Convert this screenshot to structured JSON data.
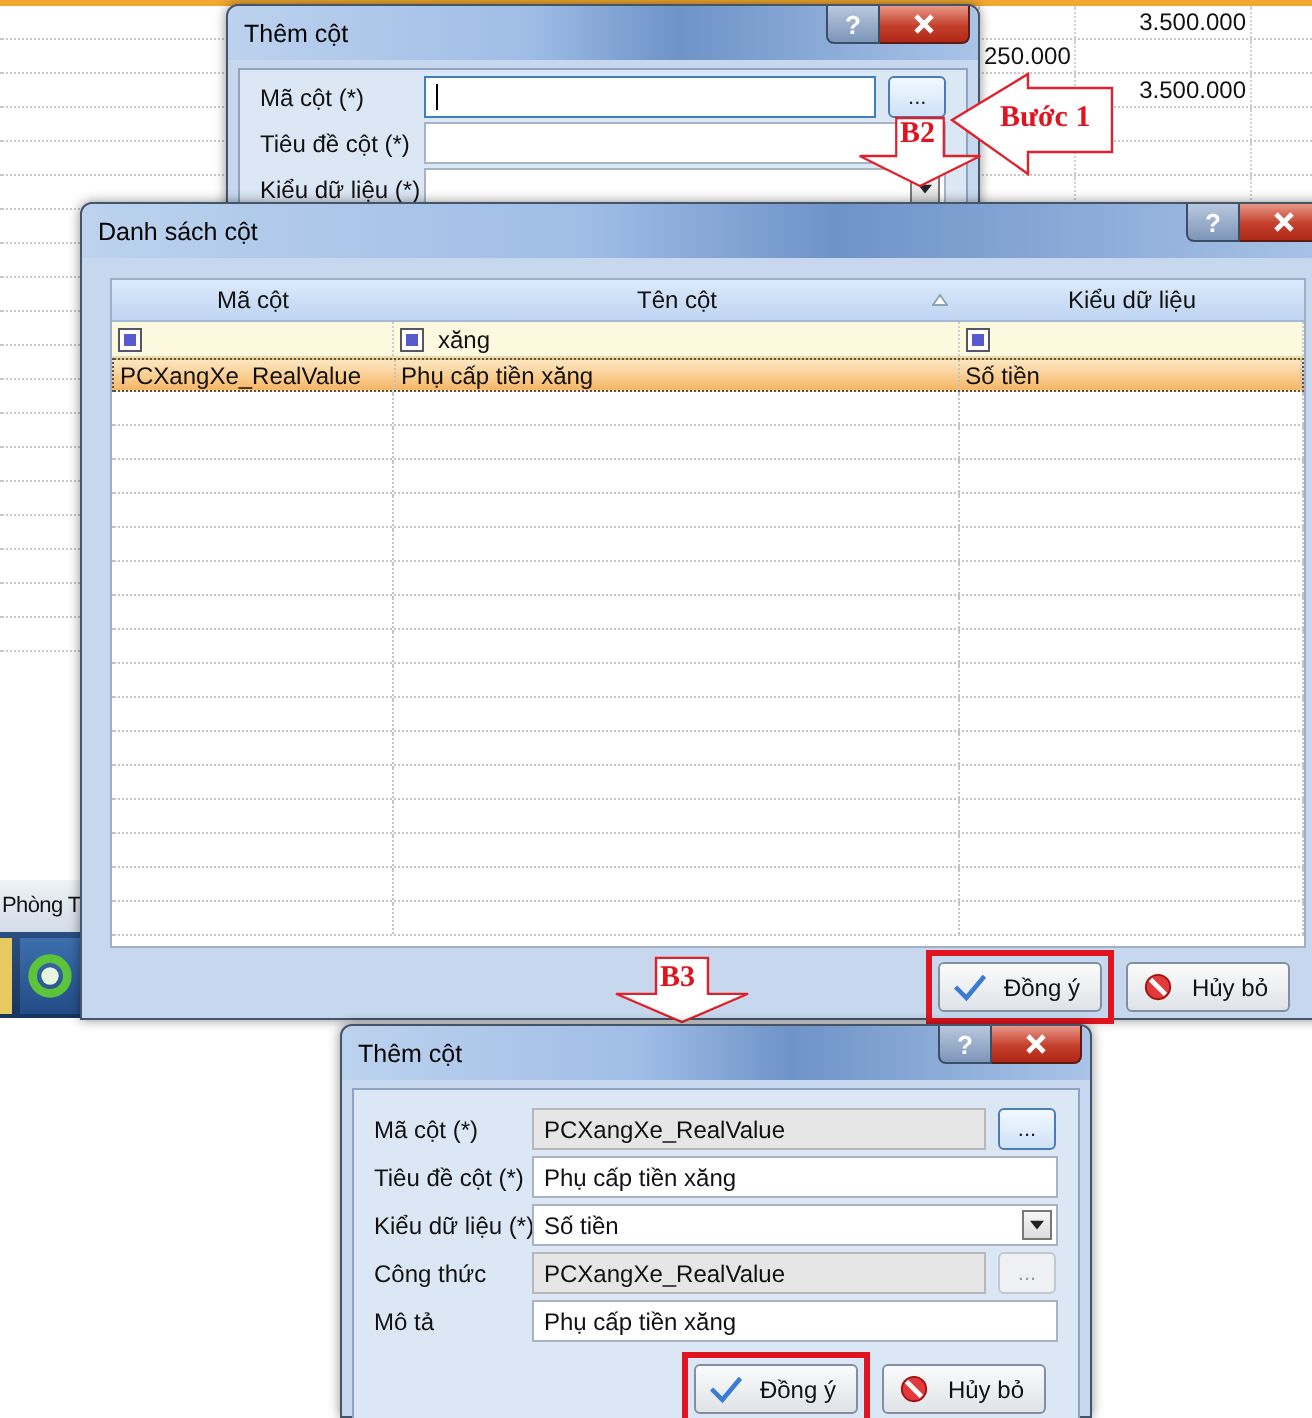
{
  "sheet": {
    "rows": [
      {
        "column_3": "3.500.000"
      },
      {
        "column_2": "250.000"
      },
      {
        "column_3": "3.500.000"
      }
    ],
    "tab": "Phòng T"
  },
  "add_column_dialogs": [
    {
      "title": "Thêm cột",
      "help_label": "?",
      "fields": [
        {
          "label": "Mã cột (*)",
          "kind": "browse",
          "focused": true,
          "disabled": false,
          "browse_label": "...",
          "browse_disabled": false
        },
        {
          "label": "Tiêu đề cột (*)",
          "kind": "text",
          "focused": false,
          "disabled": false
        },
        {
          "label": "Kiểu dữ liệu (*)",
          "kind": "select",
          "focused": false,
          "disabled": false
        }
      ]
    },
    {
      "title": "Thêm cột",
      "help_label": "?",
      "fields": [
        {
          "label": "Mã cột (*)",
          "kind": "browse",
          "value": "PCXangXe_RealValue",
          "focused": false,
          "disabled": true,
          "browse_label": "...",
          "browse_disabled": false
        },
        {
          "label": "Tiêu đề cột (*)",
          "kind": "text",
          "value": "Phụ cấp tiền xăng",
          "focused": false,
          "disabled": false
        },
        {
          "label": "Kiểu dữ liệu (*)",
          "kind": "select",
          "value": "Số tiền",
          "focused": false,
          "disabled": false
        },
        {
          "label": "Công thức",
          "kind": "browse",
          "value": "PCXangXe_RealValue",
          "focused": false,
          "disabled": true,
          "browse_label": "...",
          "browse_disabled": true
        },
        {
          "label": "Mô tả",
          "kind": "text",
          "value": "Phụ cấp tiền xăng",
          "focused": false,
          "disabled": false
        }
      ],
      "buttons": [
        {
          "label": "Đồng ý",
          "kind": "ok",
          "highlighted": true
        },
        {
          "label": "Hủy bỏ",
          "kind": "cancel",
          "highlighted": false
        }
      ]
    }
  ],
  "column_list_dialog": {
    "title": "Danh sách cột",
    "help_label": "?",
    "columns": [
      {
        "label": "Mã cột",
        "sorted": false
      },
      {
        "label": "Tên cột",
        "sorted": true,
        "filter": "xăng"
      },
      {
        "label": "Kiểu dữ liệu",
        "sorted": false
      }
    ],
    "rows": [
      {
        "cells": [
          "PCXangXe_RealValue",
          "Phụ cấp tiền xăng",
          "Số tiền"
        ],
        "selected": true
      }
    ],
    "buttons": [
      {
        "label": "Đồng ý",
        "kind": "ok",
        "highlighted": true
      },
      {
        "label": "Hủy bỏ",
        "kind": "cancel",
        "highlighted": false
      }
    ]
  },
  "annotations": [
    {
      "kind": "left-arrow",
      "text": "Bước 1"
    },
    {
      "kind": "down-arrow",
      "text": "B2"
    },
    {
      "kind": "down-arrow",
      "text": "B3"
    }
  ]
}
